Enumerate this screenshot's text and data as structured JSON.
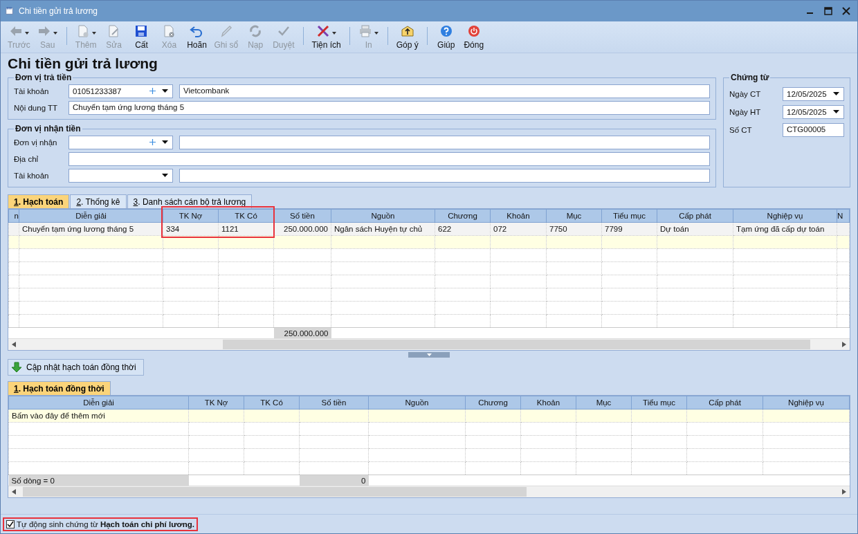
{
  "window": {
    "title": "Chi tiền gửi trả lương"
  },
  "toolbar_groups": [
    {
      "items": [
        {
          "label": "Trước",
          "kind": "back",
          "disabled": true,
          "dropdown": true
        },
        {
          "label": "Sau",
          "kind": "forward",
          "disabled": true,
          "dropdown": true
        }
      ]
    },
    {
      "items": [
        {
          "label": "Thêm",
          "kind": "new-doc",
          "disabled": true,
          "dropdown": true
        },
        {
          "label": "Sửa",
          "kind": "edit-doc",
          "disabled": true,
          "dropdown": false
        },
        {
          "label": "Cất",
          "kind": "save",
          "disabled": false,
          "dropdown": false
        },
        {
          "label": "Xóa",
          "kind": "delete-doc",
          "disabled": true,
          "dropdown": false
        },
        {
          "label": "Hoãn",
          "kind": "undo",
          "disabled": false,
          "dropdown": false
        },
        {
          "label": "Ghi sổ",
          "kind": "pencil",
          "disabled": true,
          "dropdown": false
        },
        {
          "label": "Nạp",
          "kind": "refresh",
          "disabled": true,
          "dropdown": false
        },
        {
          "label": "Duyệt",
          "kind": "check",
          "disabled": true,
          "dropdown": false
        }
      ]
    },
    {
      "items": [
        {
          "label": "Tiện ích",
          "kind": "tools",
          "disabled": false,
          "dropdown": true
        }
      ]
    },
    {
      "items": [
        {
          "label": "In",
          "kind": "printer",
          "disabled": true,
          "dropdown": true
        }
      ]
    },
    {
      "items": [
        {
          "label": "Góp ý",
          "kind": "feedback",
          "disabled": false,
          "dropdown": false
        }
      ]
    },
    {
      "items": [
        {
          "label": "Giúp",
          "kind": "help",
          "disabled": false,
          "dropdown": false
        },
        {
          "label": "Đóng",
          "kind": "power",
          "disabled": false,
          "dropdown": false
        }
      ]
    }
  ],
  "page_title": "Chi tiền gửi trả lương",
  "payer": {
    "legend": "Đơn vị trả tiền",
    "rows": [
      {
        "label": "Tài khoản",
        "kind": "combo-pair",
        "value": "01051233387",
        "add": true,
        "second_value": "Vietcombank"
      },
      {
        "label": "Nội dung TT",
        "kind": "text",
        "value": "Chuyển tạm ứng lương tháng 5"
      }
    ]
  },
  "receiver": {
    "legend": "Đơn vị nhận tiền",
    "rows": [
      {
        "label": "Đơn vị nhận",
        "kind": "combo-pair",
        "add": true
      },
      {
        "label": "Địa chỉ",
        "kind": "text"
      },
      {
        "label": "Tài khoản",
        "kind": "combo-pair",
        "add": false
      }
    ]
  },
  "voucher": {
    "legend": "Chứng từ",
    "rows": [
      {
        "label": "Ngày CT",
        "kind": "date",
        "value": "12/05/2025"
      },
      {
        "label": "Ngày HT",
        "kind": "date",
        "value": "12/05/2025"
      },
      {
        "label": "Số CT",
        "kind": "text",
        "value": "CTG00005"
      }
    ]
  },
  "tabs": [
    {
      "mnemonic": "1",
      "label": ". Hạch toán",
      "selected": true
    },
    {
      "mnemonic": "2",
      "label": ". Thống kê",
      "selected": false
    },
    {
      "mnemonic": "3",
      "label": ". Danh sách cán bộ trả lương",
      "selected": false
    }
  ],
  "grid": {
    "columns": [
      {
        "label": "n",
        "kind": "partial"
      },
      {
        "label": "Diễn giải",
        "kind": "text"
      },
      {
        "label": "TK Nợ",
        "kind": "text",
        "highlight": true
      },
      {
        "label": "TK Có",
        "kind": "text",
        "highlight": true
      },
      {
        "label": "Số tiền",
        "kind": "money",
        "footer": "250.000.000"
      },
      {
        "label": "Nguồn",
        "kind": "text"
      },
      {
        "label": "Chương",
        "kind": "text"
      },
      {
        "label": "Khoản",
        "kind": "text"
      },
      {
        "label": "Mục",
        "kind": "text"
      },
      {
        "label": "Tiểu mục",
        "kind": "text"
      },
      {
        "label": "Cấp phát",
        "kind": "text"
      },
      {
        "label": "Nghiệp vụ",
        "kind": "text"
      },
      {
        "label": "N",
        "kind": "partial"
      }
    ],
    "rows": [
      {
        "cells": [
          "",
          "Chuyển tạm ứng lương tháng 5",
          "334",
          "1121",
          "250.000.000",
          "Ngân sách Huyện tự chủ",
          "622",
          "072",
          "7750",
          "7799",
          "Dự toán",
          "Tạm ứng đã cấp dự toán",
          ""
        ]
      }
    ]
  },
  "update_button": "Cập nhật hạch toán đồng thời",
  "tabs2": [
    {
      "mnemonic": "1",
      "label": ". Hạch toán đồng thời",
      "selected": true
    }
  ],
  "grid2": {
    "columns": [
      {
        "label": "Diễn giải",
        "kind": "text",
        "footer": "Số dòng = 0"
      },
      {
        "label": "TK Nợ",
        "kind": "text"
      },
      {
        "label": "TK Có",
        "kind": "text"
      },
      {
        "label": "Số tiền",
        "kind": "money",
        "footer": "0"
      },
      {
        "label": "Nguồn",
        "kind": "text"
      },
      {
        "label": "Chương",
        "kind": "text"
      },
      {
        "label": "Khoản",
        "kind": "text"
      },
      {
        "label": "Mục",
        "kind": "text"
      },
      {
        "label": "Tiểu mục",
        "kind": "text"
      },
      {
        "label": "Cấp phát",
        "kind": "text"
      },
      {
        "label": "Nghiệp vụ",
        "kind": "text"
      }
    ],
    "new_row_hint": "Bấm vào đây để thêm mới"
  },
  "footer": {
    "checked": true,
    "text": "Tự động sinh chứng từ **Hạch toán chi phí lương.**",
    "highlight": true
  }
}
